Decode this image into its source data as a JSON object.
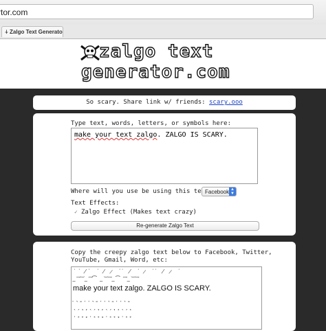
{
  "browser": {
    "address": "rtor.com",
    "tab_title": "Zalgo Text Generator"
  },
  "header": {
    "logo_line1": "zalgo text",
    "logo_line2": "generator.com"
  },
  "share": {
    "text": "So scary. Share link w/ friends: ",
    "link": "scary.ooo"
  },
  "form": {
    "prompt_label": "Type text, words, letters, or symbols here:",
    "input_value_underlined": "make your text zalgo",
    "input_value_rest": ". ZALGO IS SCARY.",
    "usage_label": "Where will you use be using this text?",
    "usage_selected": "Facebook",
    "effects_label": "Text Effects:",
    "zalgo_effect_label": "Zalgo Effect (Makes text crazy)",
    "regenerate_label": "Re-generate Zalgo Text"
  },
  "output": {
    "copy_label_line1": "Copy the creepy zalgo text below to Facebook, Twitter,",
    "copy_label_line2": "YouTube, Gmail, Word, etc:",
    "zalgo_text": "make your text zalgo. ZALGO IS SCARY.",
    "zalgo_noise_top1": "˙͘ ̸˙ ͘ ̸ ̷ ͘˙ ̸ ͘ ̷ ͘˙ ̸ ̷ ͘",
    "zalgo_noise_top2": "͟ ͠ ͝ ͟ ͠ ͡ ͟ ͝ ͠ ͟ ͡ ͠ ͟ ͝ ͠",
    "zalgo_noise_bot1": "͙ ͉ ͚ ͎ ͙ ͉ ͚ ͎ ͙ ͉ ͚ ͎ ͙ ͉ ͚",
    "zalgo_noise_bot2": "̖ ̗ ̘ ̙ ̖ ̗ ̘ ̙ ̖ ̗ ̘ ̙ ̖ ̗ ̘",
    "zalgo_noise_bot3": "̜ ̝ ̞ ̟ ̜ ̝ ̞ ̟ ̜ ̝ ̞ ̟ ̜ ̝ ̞"
  },
  "colors": {
    "page_bg": "#2a2a2a",
    "link": "#1a3fc4",
    "select_accent": "#3b7be0"
  }
}
